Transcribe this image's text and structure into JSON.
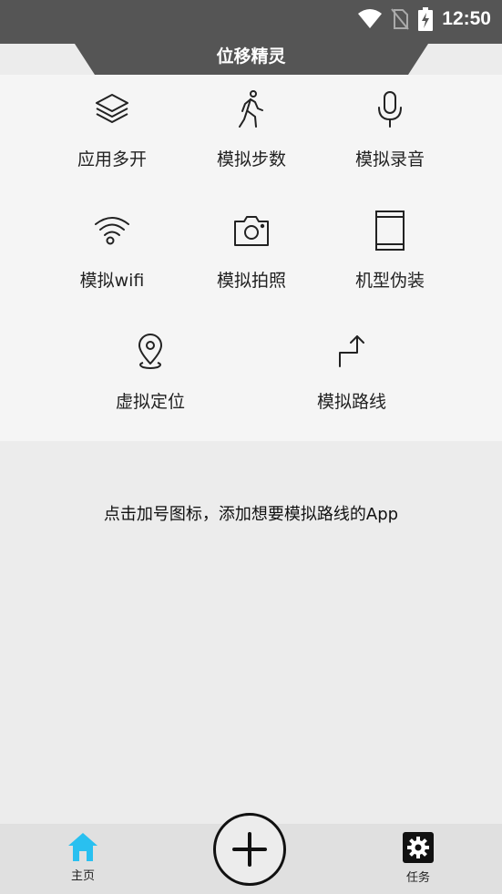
{
  "status_bar": {
    "time": "12:50",
    "icons": [
      "wifi-icon",
      "no-sim-icon",
      "battery-charging-icon"
    ]
  },
  "app": {
    "title": "位移精灵"
  },
  "features": [
    {
      "label": "应用多开",
      "icon": "layers-icon"
    },
    {
      "label": "模拟步数",
      "icon": "walking-person-icon"
    },
    {
      "label": "模拟录音",
      "icon": "microphone-icon"
    },
    {
      "label": "模拟wifi",
      "icon": "wifi-icon"
    },
    {
      "label": "模拟拍照",
      "icon": "camera-icon"
    },
    {
      "label": "机型伪装",
      "icon": "phone-device-icon"
    },
    {
      "label": "虚拟定位",
      "icon": "location-pin-icon"
    },
    {
      "label": "模拟路线",
      "icon": "route-arrow-icon"
    }
  ],
  "hint_text": "点击加号图标，添加想要模拟路线的App",
  "bottom_nav": {
    "home_label": "主页",
    "task_label": "任务",
    "add_icon": "plus-icon",
    "active_color": "#29c0f0"
  }
}
